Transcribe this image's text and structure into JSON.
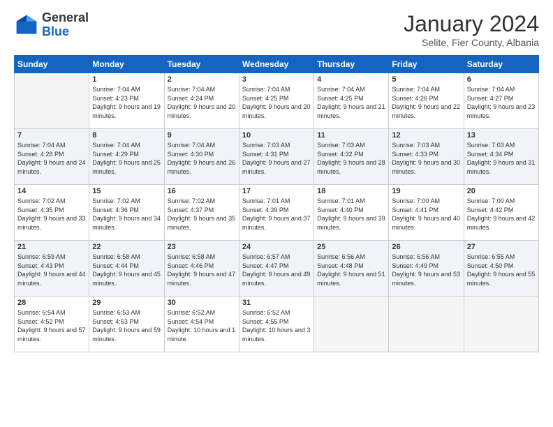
{
  "header": {
    "logo_general": "General",
    "logo_blue": "Blue",
    "month_title": "January 2024",
    "subtitle": "Selite, Fier County, Albania"
  },
  "days_of_week": [
    "Sunday",
    "Monday",
    "Tuesday",
    "Wednesday",
    "Thursday",
    "Friday",
    "Saturday"
  ],
  "weeks": [
    [
      {
        "day": "",
        "sunrise": "",
        "sunset": "",
        "daylight": ""
      },
      {
        "day": "1",
        "sunrise": "Sunrise: 7:04 AM",
        "sunset": "Sunset: 4:23 PM",
        "daylight": "Daylight: 9 hours and 19 minutes."
      },
      {
        "day": "2",
        "sunrise": "Sunrise: 7:04 AM",
        "sunset": "Sunset: 4:24 PM",
        "daylight": "Daylight: 9 hours and 20 minutes."
      },
      {
        "day": "3",
        "sunrise": "Sunrise: 7:04 AM",
        "sunset": "Sunset: 4:25 PM",
        "daylight": "Daylight: 9 hours and 20 minutes."
      },
      {
        "day": "4",
        "sunrise": "Sunrise: 7:04 AM",
        "sunset": "Sunset: 4:25 PM",
        "daylight": "Daylight: 9 hours and 21 minutes."
      },
      {
        "day": "5",
        "sunrise": "Sunrise: 7:04 AM",
        "sunset": "Sunset: 4:26 PM",
        "daylight": "Daylight: 9 hours and 22 minutes."
      },
      {
        "day": "6",
        "sunrise": "Sunrise: 7:04 AM",
        "sunset": "Sunset: 4:27 PM",
        "daylight": "Daylight: 9 hours and 23 minutes."
      }
    ],
    [
      {
        "day": "7",
        "sunrise": "Sunrise: 7:04 AM",
        "sunset": "Sunset: 4:28 PM",
        "daylight": "Daylight: 9 hours and 24 minutes."
      },
      {
        "day": "8",
        "sunrise": "Sunrise: 7:04 AM",
        "sunset": "Sunset: 4:29 PM",
        "daylight": "Daylight: 9 hours and 25 minutes."
      },
      {
        "day": "9",
        "sunrise": "Sunrise: 7:04 AM",
        "sunset": "Sunset: 4:30 PM",
        "daylight": "Daylight: 9 hours and 26 minutes."
      },
      {
        "day": "10",
        "sunrise": "Sunrise: 7:03 AM",
        "sunset": "Sunset: 4:31 PM",
        "daylight": "Daylight: 9 hours and 27 minutes."
      },
      {
        "day": "11",
        "sunrise": "Sunrise: 7:03 AM",
        "sunset": "Sunset: 4:32 PM",
        "daylight": "Daylight: 9 hours and 28 minutes."
      },
      {
        "day": "12",
        "sunrise": "Sunrise: 7:03 AM",
        "sunset": "Sunset: 4:33 PM",
        "daylight": "Daylight: 9 hours and 30 minutes."
      },
      {
        "day": "13",
        "sunrise": "Sunrise: 7:03 AM",
        "sunset": "Sunset: 4:34 PM",
        "daylight": "Daylight: 9 hours and 31 minutes."
      }
    ],
    [
      {
        "day": "14",
        "sunrise": "Sunrise: 7:02 AM",
        "sunset": "Sunset: 4:35 PM",
        "daylight": "Daylight: 9 hours and 33 minutes."
      },
      {
        "day": "15",
        "sunrise": "Sunrise: 7:02 AM",
        "sunset": "Sunset: 4:36 PM",
        "daylight": "Daylight: 9 hours and 34 minutes."
      },
      {
        "day": "16",
        "sunrise": "Sunrise: 7:02 AM",
        "sunset": "Sunset: 4:37 PM",
        "daylight": "Daylight: 9 hours and 35 minutes."
      },
      {
        "day": "17",
        "sunrise": "Sunrise: 7:01 AM",
        "sunset": "Sunset: 4:39 PM",
        "daylight": "Daylight: 9 hours and 37 minutes."
      },
      {
        "day": "18",
        "sunrise": "Sunrise: 7:01 AM",
        "sunset": "Sunset: 4:40 PM",
        "daylight": "Daylight: 9 hours and 39 minutes."
      },
      {
        "day": "19",
        "sunrise": "Sunrise: 7:00 AM",
        "sunset": "Sunset: 4:41 PM",
        "daylight": "Daylight: 9 hours and 40 minutes."
      },
      {
        "day": "20",
        "sunrise": "Sunrise: 7:00 AM",
        "sunset": "Sunset: 4:42 PM",
        "daylight": "Daylight: 9 hours and 42 minutes."
      }
    ],
    [
      {
        "day": "21",
        "sunrise": "Sunrise: 6:59 AM",
        "sunset": "Sunset: 4:43 PM",
        "daylight": "Daylight: 9 hours and 44 minutes."
      },
      {
        "day": "22",
        "sunrise": "Sunrise: 6:58 AM",
        "sunset": "Sunset: 4:44 PM",
        "daylight": "Daylight: 9 hours and 45 minutes."
      },
      {
        "day": "23",
        "sunrise": "Sunrise: 6:58 AM",
        "sunset": "Sunset: 4:46 PM",
        "daylight": "Daylight: 9 hours and 47 minutes."
      },
      {
        "day": "24",
        "sunrise": "Sunrise: 6:57 AM",
        "sunset": "Sunset: 4:47 PM",
        "daylight": "Daylight: 9 hours and 49 minutes."
      },
      {
        "day": "25",
        "sunrise": "Sunrise: 6:56 AM",
        "sunset": "Sunset: 4:48 PM",
        "daylight": "Daylight: 9 hours and 51 minutes."
      },
      {
        "day": "26",
        "sunrise": "Sunrise: 6:56 AM",
        "sunset": "Sunset: 4:49 PM",
        "daylight": "Daylight: 9 hours and 53 minutes."
      },
      {
        "day": "27",
        "sunrise": "Sunrise: 6:55 AM",
        "sunset": "Sunset: 4:50 PM",
        "daylight": "Daylight: 9 hours and 55 minutes."
      }
    ],
    [
      {
        "day": "28",
        "sunrise": "Sunrise: 6:54 AM",
        "sunset": "Sunset: 4:52 PM",
        "daylight": "Daylight: 9 hours and 57 minutes."
      },
      {
        "day": "29",
        "sunrise": "Sunrise: 6:53 AM",
        "sunset": "Sunset: 4:53 PM",
        "daylight": "Daylight: 9 hours and 59 minutes."
      },
      {
        "day": "30",
        "sunrise": "Sunrise: 6:52 AM",
        "sunset": "Sunset: 4:54 PM",
        "daylight": "Daylight: 10 hours and 1 minute."
      },
      {
        "day": "31",
        "sunrise": "Sunrise: 6:52 AM",
        "sunset": "Sunset: 4:55 PM",
        "daylight": "Daylight: 10 hours and 3 minutes."
      },
      {
        "day": "",
        "sunrise": "",
        "sunset": "",
        "daylight": ""
      },
      {
        "day": "",
        "sunrise": "",
        "sunset": "",
        "daylight": ""
      },
      {
        "day": "",
        "sunrise": "",
        "sunset": "",
        "daylight": ""
      }
    ]
  ]
}
